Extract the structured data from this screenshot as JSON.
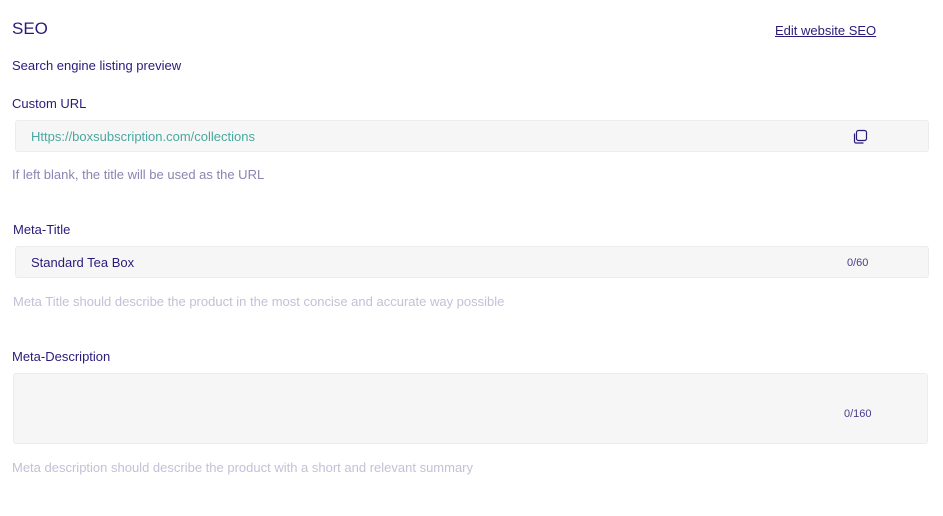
{
  "seo": {
    "title": "SEO",
    "edit_link": "Edit website SEO",
    "preview_heading": "Search engine listing preview"
  },
  "custom_url": {
    "label": "Custom URL",
    "value": "Https://boxsubscription.com/collections",
    "copy_icon": "copy-icon",
    "hint": "If left blank, the title will be used as the URL"
  },
  "meta_title": {
    "label": "Meta-Title",
    "value": "Standard Tea Box",
    "counter": "0/60",
    "hint": "Meta Title should describe the product in the most concise and accurate way possible"
  },
  "meta_description": {
    "label": "Meta-Description",
    "value": "",
    "counter": "0/160",
    "hint": "Meta description should describe the product with a short and relevant summary"
  },
  "colors": {
    "primary_text": "#2b1a7a",
    "url_text": "#4aa8a0",
    "hint_text": "#8d83b3",
    "muted_hint": "#c4c0d6",
    "field_bg": "#f6f6f6"
  }
}
